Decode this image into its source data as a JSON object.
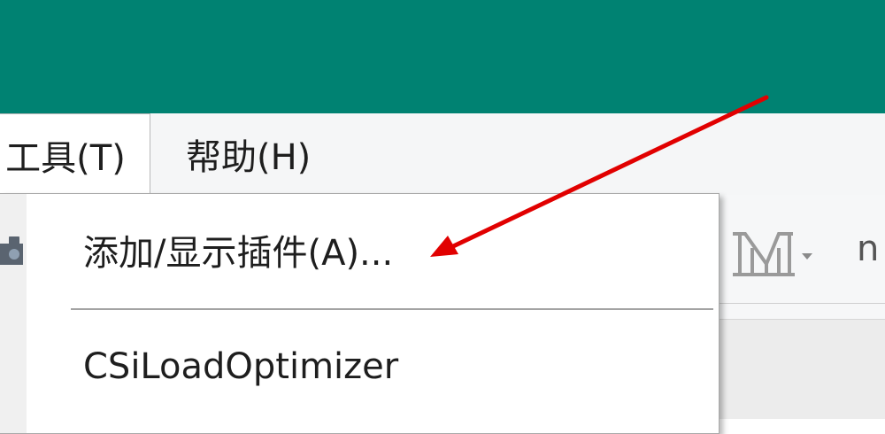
{
  "colors": {
    "titlebar": "#008272",
    "arrow": "#e10000"
  },
  "menubar": {
    "tools_label": "工具(T)",
    "help_label": "帮助(H)"
  },
  "dropdown": {
    "items": [
      {
        "label": "添加/显示插件(A)...",
        "icon": "puzzle-plugin-icon"
      },
      {
        "label": "CSiLoadOptimizer"
      }
    ]
  },
  "toolbar": {
    "icons": [
      "bridge-icon",
      "dropdown-arrow-icon"
    ],
    "partial_text": "n"
  },
  "annotation": {
    "type": "arrow",
    "color": "red"
  }
}
